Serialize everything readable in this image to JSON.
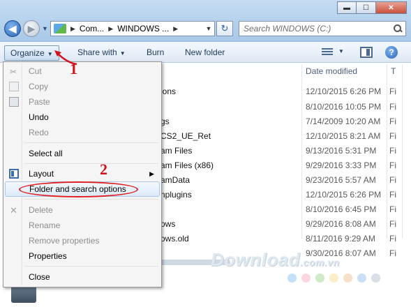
{
  "window": {
    "minimize": "▬",
    "maximize": "☐",
    "close": "✕"
  },
  "nav": {
    "back": "◀",
    "forward": "▶",
    "history": "▼"
  },
  "address": {
    "segments": [
      "Com...",
      "WINDOWS ..."
    ],
    "separator": "▶",
    "dropdown": "▼",
    "refresh": "↻"
  },
  "search": {
    "placeholder": "Search WINDOWS (C:)"
  },
  "toolbar": {
    "organize": "Organize",
    "share_with": "Share with",
    "burn": "Burn",
    "new_folder": "New folder",
    "caret": "▼",
    "help": "?"
  },
  "columns": {
    "date_modified": "Date modified",
    "type": "T"
  },
  "files": [
    {
      "name": "ions",
      "date": "12/10/2015 6:26 PM",
      "type": "Fi"
    },
    {
      "name": "",
      "date": "8/10/2016 10:05 PM",
      "type": "Fi"
    },
    {
      "name": "gs",
      "date": "7/14/2009 10:20 AM",
      "type": "Fi"
    },
    {
      "name": "CS2_UE_Ret",
      "date": "12/10/2015 8:21 AM",
      "type": "Fi"
    },
    {
      "name": "am Files",
      "date": "9/13/2016 5:31 PM",
      "type": "Fi"
    },
    {
      "name": "am Files (x86)",
      "date": "9/29/2016 3:33 PM",
      "type": "Fi"
    },
    {
      "name": "amData",
      "date": "9/23/2016 5:57 AM",
      "type": "Fi"
    },
    {
      "name": "nplugins",
      "date": "12/10/2015 6:26 PM",
      "type": "Fi"
    },
    {
      "name": "",
      "date": "8/10/2016 6:45 PM",
      "type": "Fi"
    },
    {
      "name": "ows",
      "date": "9/29/2016 8:08 AM",
      "type": "Fi"
    },
    {
      "name": "ows.old",
      "date": "8/11/2016 9:29 AM",
      "type": "Fi"
    },
    {
      "name": "",
      "date": "9/30/2016 8:07 AM",
      "type": "Fi"
    }
  ],
  "menu": {
    "cut": "Cut",
    "copy": "Copy",
    "paste": "Paste",
    "undo": "Undo",
    "redo": "Redo",
    "select_all": "Select all",
    "layout": "Layout",
    "submenu_arrow": "▶",
    "folder_options": "Folder and search options",
    "delete": "Delete",
    "rename": "Rename",
    "remove_properties": "Remove properties",
    "properties": "Properties",
    "close": "Close"
  },
  "annotations": {
    "step1": "1",
    "step2": "2",
    "annotation_color": "#d0131b"
  },
  "watermark": {
    "brand": "Download",
    "domain": ".com.vn",
    "dot_colors": [
      "#8fc9f0",
      "#f5b6c6",
      "#a7d99a",
      "#f7e19a",
      "#f3c49c",
      "#9fc5ec",
      "#b8c4d3"
    ]
  },
  "colors": {
    "titlebar": "#c4dcf2",
    "menu_bg": "#f5f5f5",
    "hover": "#dceaf8",
    "accent": "#2a63b5"
  }
}
